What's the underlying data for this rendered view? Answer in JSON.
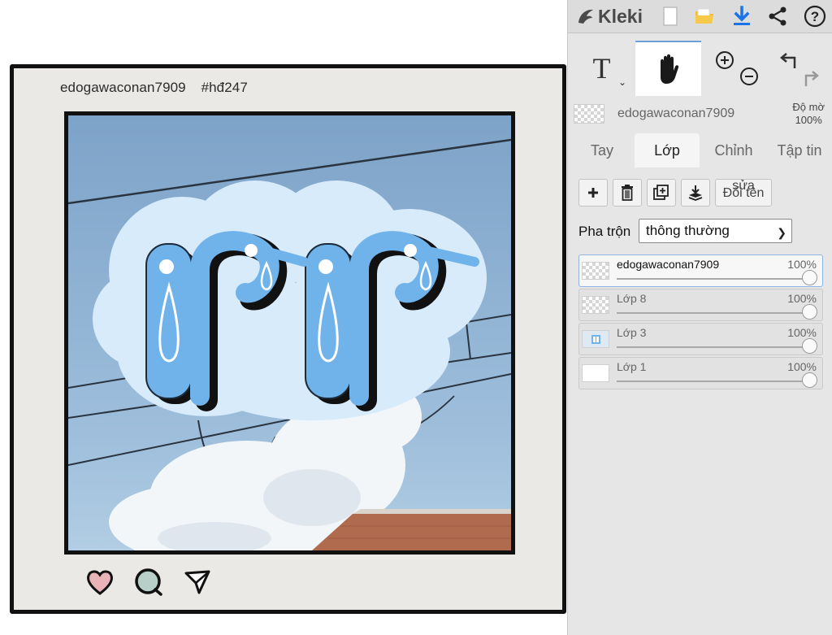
{
  "app": {
    "name": "Kleki"
  },
  "canvas": {
    "post_username": "edogawaconan7909",
    "post_hashtag": "#hđ247",
    "reactions": [
      {
        "icon": "heart-icon",
        "color": "#e8b4b8"
      },
      {
        "icon": "comment-icon",
        "color": "#b8cfc9"
      },
      {
        "icon": "send-icon",
        "color": "#ffffff"
      }
    ]
  },
  "toolbar": {
    "icons": [
      "new-file-icon",
      "open-folder-icon",
      "download-icon",
      "share-icon",
      "help-icon"
    ],
    "text_tool": "T"
  },
  "current_layer": {
    "name": "edogawaconan7909",
    "opacity_label": "Độ mờ",
    "opacity_value": "100%"
  },
  "tabs": [
    {
      "label": "Tay",
      "active": false
    },
    {
      "label": "Lớp",
      "active": true
    },
    {
      "label": "Chỉnh",
      "active": false
    },
    {
      "label": "Tập tin",
      "active": false
    }
  ],
  "layer_actions": {
    "rename_label_top": "sửa",
    "rename_label": "Đổi tên"
  },
  "blend": {
    "label": "Pha trộn",
    "value": "thông thường"
  },
  "layers": [
    {
      "name": "edogawaconan7909",
      "opacity": "100%",
      "active": true,
      "thumb": "checker"
    },
    {
      "name": "Lớp 8",
      "opacity": "100%",
      "active": false,
      "thumb": "checker"
    },
    {
      "name": "Lớp 3",
      "opacity": "100%",
      "active": false,
      "thumb": "image"
    },
    {
      "name": "Lớp 1",
      "opacity": "100%",
      "active": false,
      "thumb": "white"
    }
  ],
  "colors": {
    "accent": "#1a73e8",
    "panel_bg": "#e6e6e6",
    "art_blue": "#6fb3ea",
    "cloud": "#d6eafa"
  }
}
